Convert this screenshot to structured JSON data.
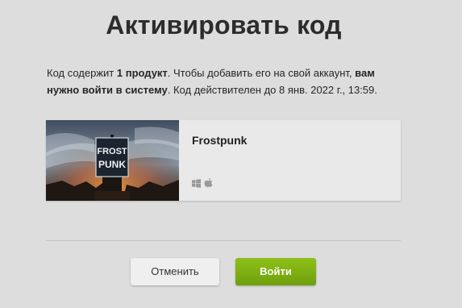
{
  "page": {
    "title": "Активировать код"
  },
  "description": {
    "part1": "Код содержит ",
    "product_count": "1 продукт",
    "part2": ". Чтобы добавить его на свой аккаунт, ",
    "login_needed": "вам нужно войти в систему",
    "part3": ". Код действителен до 8 янв. 2022 г., 13:59."
  },
  "product": {
    "name": "Frostpunk",
    "cover_logo_line1": "FROST",
    "cover_logo_line2": "PUNK",
    "platforms": [
      "windows-icon",
      "apple-icon"
    ]
  },
  "buttons": {
    "cancel_label": "Отменить",
    "login_label": "Войти"
  },
  "colors": {
    "background": "#dddddd",
    "login_button": "#7cb014",
    "card": "#e9e9e9"
  }
}
